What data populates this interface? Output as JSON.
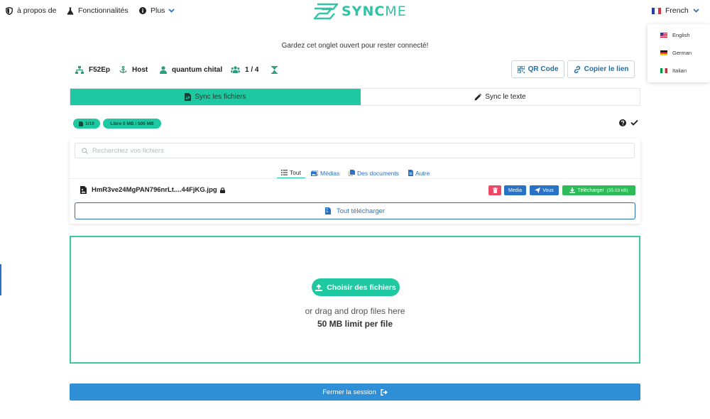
{
  "nav": {
    "about": "à propos de",
    "features": "Fonctionnalités",
    "more": "Plus"
  },
  "logo": {
    "sync": "SYNC",
    "me": "ME"
  },
  "language": {
    "current": "French",
    "options": [
      "English",
      "German",
      "Italian"
    ]
  },
  "notice": "Gardez cet onglet ouvert pour rester connecté!",
  "session": {
    "id": "F52Ep",
    "role": "Host",
    "user": "quantum chital",
    "participants": "1 / 4",
    "qr_label": "QR Code",
    "copy_label": "Copier le lien"
  },
  "tabs": {
    "files": "Sync les fichiers",
    "text": "Sync le texte",
    "active": "files"
  },
  "badges": {
    "file_count": "1/10",
    "free_space": "Libre 0 MB / 500 MB"
  },
  "search": {
    "placeholder": "Recherchez vos fichiers"
  },
  "filters": {
    "all": "Tout",
    "media": "Médias",
    "documents": "Des documents",
    "other": "Autre",
    "active": "all"
  },
  "files": [
    {
      "name": "HmR3ve24MgPAN796nrLt....44FjKG.jpg",
      "type_label": "Media",
      "sender": "Vous",
      "download_label": "Télécharger",
      "size": "(35.03 kB)"
    }
  ],
  "download_all": "Tout télécharger",
  "dropzone": {
    "button": "Choisir des fichiers",
    "hint": "or drag and drop files here",
    "limit": "50 MB limit per file"
  },
  "close_session": "Fermer la session",
  "colors": {
    "accent": "#1ec8a0",
    "primary": "#2a72c4",
    "danger": "#ee4866",
    "success": "#2fbb5a",
    "close_bar": "#2e8fd6"
  }
}
